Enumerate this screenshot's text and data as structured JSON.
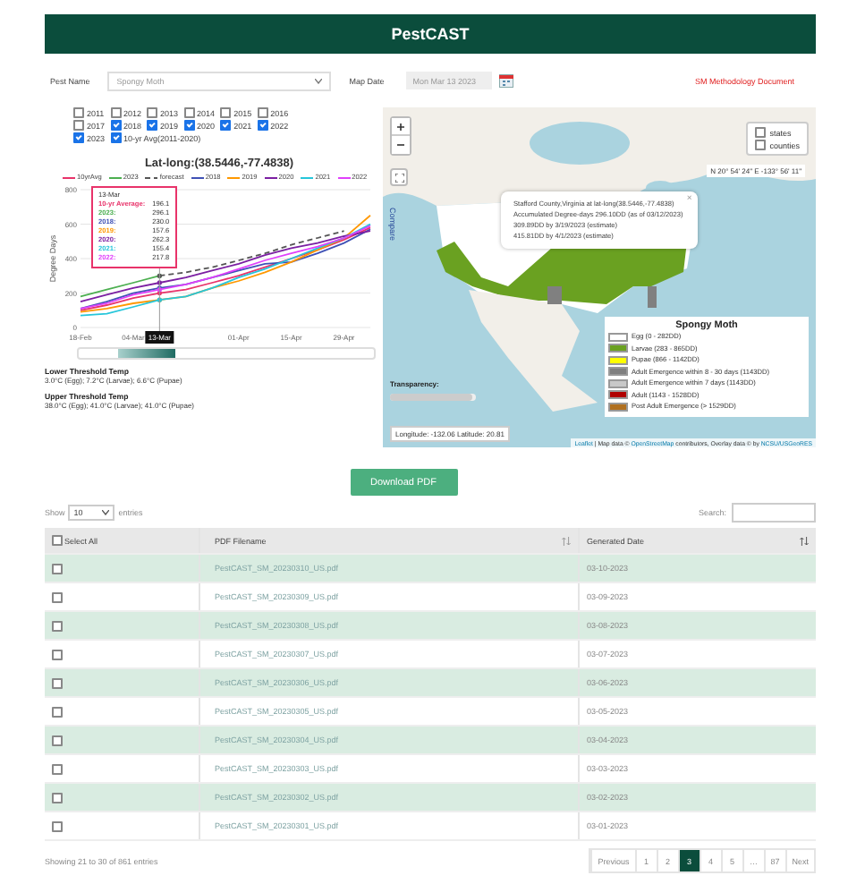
{
  "header": {
    "title": "PestCAST"
  },
  "controls": {
    "pest_label": "Pest Name",
    "pest_value": "Spongy Moth",
    "date_label": "Map Date",
    "date_value": "Mon Mar 13 2023",
    "link": "SM Methodology Document"
  },
  "years": [
    {
      "label": "2011",
      "checked": false
    },
    {
      "label": "2012",
      "checked": false
    },
    {
      "label": "2013",
      "checked": false
    },
    {
      "label": "2014",
      "checked": false
    },
    {
      "label": "2015",
      "checked": false
    },
    {
      "label": "2016",
      "checked": false
    },
    {
      "label": "2017",
      "checked": false
    },
    {
      "label": "2018",
      "checked": true
    },
    {
      "label": "2019",
      "checked": true
    },
    {
      "label": "2020",
      "checked": true
    },
    {
      "label": "2021",
      "checked": true
    },
    {
      "label": "2022",
      "checked": true
    },
    {
      "label": "2023",
      "checked": true
    },
    {
      "label": "10-yr Avg(2011-2020)",
      "checked": true
    }
  ],
  "chart": {
    "chart_data": {
      "type": "line",
      "title": "Lat-long:(38.5446,-77.4838)",
      "ylabel": "Degree Days",
      "categories": [
        "18-Feb",
        null,
        "04-Mar",
        "13-Mar",
        null,
        null,
        "01-Apr",
        null,
        "15-Apr",
        null,
        "29-Apr",
        null
      ],
      "ylim": [
        0,
        800
      ],
      "yticks": [
        0,
        200,
        400,
        600,
        800
      ],
      "grid": true,
      "legend": "top",
      "series": [
        {
          "name": "10yrAvg",
          "color": "#e8336a",
          "values": [
            100,
            130,
            170,
            200,
            220,
            260,
            300,
            350,
            400,
            450,
            510,
            580
          ]
        },
        {
          "name": "2023",
          "color": "#4caf50",
          "values": [
            180,
            220,
            260,
            300,
            null,
            null,
            null,
            null,
            null,
            null,
            null,
            null
          ]
        },
        {
          "name": "forecast",
          "color": "#555555",
          "line_style": "dashed",
          "values": [
            null,
            null,
            null,
            300,
            320,
            350,
            390,
            430,
            480,
            520,
            560,
            null
          ]
        },
        {
          "name": "2018",
          "color": "#3f51b5",
          "values": [
            110,
            150,
            200,
            230,
            250,
            290,
            330,
            370,
            380,
            430,
            490,
            570
          ]
        },
        {
          "name": "2019",
          "color": "#ff9800",
          "values": [
            90,
            110,
            140,
            160,
            180,
            230,
            270,
            320,
            380,
            450,
            520,
            650
          ]
        },
        {
          "name": "2020",
          "color": "#7b1fa2",
          "values": [
            150,
            190,
            230,
            260,
            290,
            330,
            370,
            420,
            460,
            490,
            530,
            560
          ]
        },
        {
          "name": "2021",
          "color": "#26c6da",
          "values": [
            70,
            80,
            120,
            160,
            180,
            230,
            290,
            340,
            400,
            460,
            520,
            600
          ]
        },
        {
          "name": "2022",
          "color": "#e040fb",
          "values": [
            110,
            140,
            190,
            220,
            250,
            290,
            340,
            390,
            430,
            470,
            520,
            590
          ]
        }
      ]
    },
    "tooltip": {
      "title": "13-Mar",
      "rows": [
        {
          "label": "10-yr Average:",
          "value": "196.1",
          "color": "#e8336a"
        },
        {
          "label": "2023:",
          "value": "296.1",
          "color": "#4caf50"
        },
        {
          "label": "2018:",
          "value": "230.0",
          "color": "#3f51b5"
        },
        {
          "label": "2019:",
          "value": "157.6",
          "color": "#ff9800"
        },
        {
          "label": "2020:",
          "value": "262.3",
          "color": "#7b1fa2"
        },
        {
          "label": "2021:",
          "value": "155.4",
          "color": "#26c6da"
        },
        {
          "label": "2022:",
          "value": "217.8",
          "color": "#e040fb"
        }
      ]
    }
  },
  "thresholds": [
    {
      "title": "Lower Threshold Temp",
      "text": "3.0°C (Egg); 7.2°C (Larvae); 6.6°C (Pupae)"
    },
    {
      "title": "Upper Threshold Temp",
      "text": "38.0°C (Egg); 41.0°C (Larvae); 41.0°C (Pupae)"
    }
  ],
  "map": {
    "compare": "Compare",
    "layers": [
      {
        "label": "states",
        "checked": false
      },
      {
        "label": "counties",
        "checked": false
      }
    ],
    "coords": "N 20° 54' 24\" E -133° 56' 11\"",
    "popup": {
      "lines": [
        "Stafford County,Virginia at lat-long(38.5446,-77.4838)",
        "Accumulated Degree-days 296.10DD (as of 03/12/2023)",
        "309.89DD by 3/19/2023 (estimate)",
        "415.81DD by 4/1/2023 (estimate)"
      ],
      "close": "×"
    },
    "legend": {
      "title": "Spongy Moth",
      "items": [
        {
          "label": "Egg (0 - 282DD)",
          "color": "#ffffff"
        },
        {
          "label": "Larvae (283 - 865DD)",
          "color": "#6aa121"
        },
        {
          "label": "Pupae (866 - 1142DD)",
          "color": "#ffff00"
        },
        {
          "label": "Adult Emergence within 8 - 30 days (1143DD)",
          "color": "#808080"
        },
        {
          "label": "Adult Emergence within 7 days (1143DD)",
          "color": "#c8c8c8"
        },
        {
          "label": "Adult (1143 - 1528DD)",
          "color": "#b00000"
        },
        {
          "label": "Post Adult Emergence (> 1529DD)",
          "color": "#b07020"
        }
      ]
    },
    "transparency": {
      "label": "Transparency:",
      "level": 0.95
    },
    "position": "Longitude: -132.06 Latitude: 20.81",
    "attribution": {
      "leaflet": "Leaflet",
      "text1": "| Map data ©",
      "osm": "OpenStreetMap",
      "text2": "contributors, Overlay data © by",
      "source": "NCSU/USGeoRES"
    }
  },
  "download_button": "Download PDF",
  "length": {
    "show": "Show",
    "value": "10",
    "entries": "entries"
  },
  "search": {
    "label": "Search:"
  },
  "table": {
    "columns": [
      "Select All",
      "PDF Filename",
      "Generated Date"
    ],
    "select_all_checked": false,
    "rows": [
      {
        "checked": false,
        "file": "PestCAST_SM_20230310_US.pdf",
        "date": "03-10-2023"
      },
      {
        "checked": false,
        "file": "PestCAST_SM_20230309_US.pdf",
        "date": "03-09-2023"
      },
      {
        "checked": false,
        "file": "PestCAST_SM_20230308_US.pdf",
        "date": "03-08-2023"
      },
      {
        "checked": false,
        "file": "PestCAST_SM_20230307_US.pdf",
        "date": "03-07-2023"
      },
      {
        "checked": false,
        "file": "PestCAST_SM_20230306_US.pdf",
        "date": "03-06-2023"
      },
      {
        "checked": false,
        "file": "PestCAST_SM_20230305_US.pdf",
        "date": "03-05-2023"
      },
      {
        "checked": false,
        "file": "PestCAST_SM_20230304_US.pdf",
        "date": "03-04-2023"
      },
      {
        "checked": false,
        "file": "PestCAST_SM_20230303_US.pdf",
        "date": "03-03-2023"
      },
      {
        "checked": false,
        "file": "PestCAST_SM_20230302_US.pdf",
        "date": "03-02-2023"
      },
      {
        "checked": false,
        "file": "PestCAST_SM_20230301_US.pdf",
        "date": "03-01-2023"
      }
    ]
  },
  "info": "Showing 21 to 30 of 861 entries",
  "pagination": [
    {
      "label": "Previous",
      "selected": false
    },
    {
      "label": "1",
      "selected": false
    },
    {
      "label": "2",
      "selected": false
    },
    {
      "label": "3",
      "selected": true
    },
    {
      "label": "4",
      "selected": false
    },
    {
      "label": "5",
      "selected": false
    },
    {
      "label": "…",
      "selected": false
    },
    {
      "label": "87",
      "selected": false
    },
    {
      "label": "Next",
      "selected": false
    }
  ]
}
